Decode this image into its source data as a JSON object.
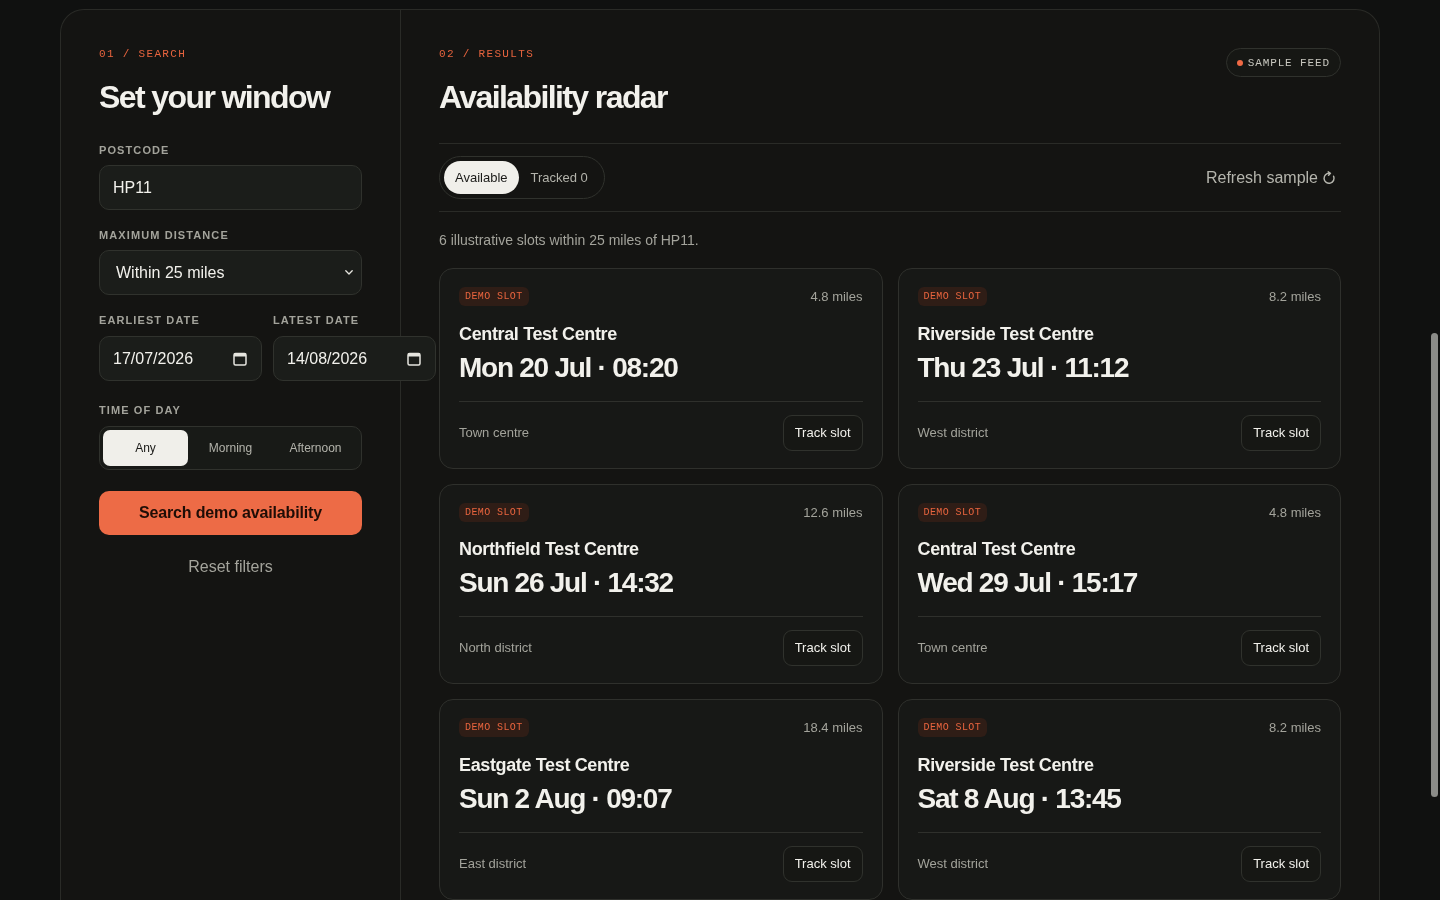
{
  "search_panel": {
    "section_label": "01 / SEARCH",
    "title": "Set your window",
    "postcode": {
      "label": "POSTCODE",
      "value": "HP11"
    },
    "max_distance": {
      "label": "MAXIMUM DISTANCE",
      "value": "Within 25 miles"
    },
    "earliest_date": {
      "label": "EARLIEST DATE",
      "value": "17/07/2026"
    },
    "latest_date": {
      "label": "LATEST DATE",
      "value": "14/08/2026"
    },
    "time_of_day": {
      "label": "TIME OF DAY",
      "options": [
        {
          "label": "Any",
          "selected": true
        },
        {
          "label": "Morning",
          "selected": false
        },
        {
          "label": "Afternoon",
          "selected": false
        }
      ]
    },
    "search_button": "Search demo availability",
    "reset_link": "Reset filters"
  },
  "results_panel": {
    "section_label": "02 / RESULTS",
    "title": "Availability radar",
    "feed_badge": "SAMPLE FEED",
    "tabs": [
      {
        "label": "Available",
        "selected": true
      },
      {
        "label": "Tracked 0",
        "selected": false
      }
    ],
    "refresh_button": "Refresh sample",
    "summary": "6 illustrative slots within 25 miles of HP11.",
    "slots": [
      {
        "tag": "DEMO SLOT",
        "distance": "4.8 miles",
        "centre": "Central Test Centre",
        "when": "Mon 20 Jul · 08:20",
        "area": "Town centre",
        "action": "Track slot"
      },
      {
        "tag": "DEMO SLOT",
        "distance": "8.2 miles",
        "centre": "Riverside Test Centre",
        "when": "Thu 23 Jul · 11:12",
        "area": "West district",
        "action": "Track slot"
      },
      {
        "tag": "DEMO SLOT",
        "distance": "12.6 miles",
        "centre": "Northfield Test Centre",
        "when": "Sun 26 Jul · 14:32",
        "area": "North district",
        "action": "Track slot"
      },
      {
        "tag": "DEMO SLOT",
        "distance": "4.8 miles",
        "centre": "Central Test Centre",
        "when": "Wed 29 Jul · 15:17",
        "area": "Town centre",
        "action": "Track slot"
      },
      {
        "tag": "DEMO SLOT",
        "distance": "18.4 miles",
        "centre": "Eastgate Test Centre",
        "when": "Sun 2 Aug · 09:07",
        "area": "East district",
        "action": "Track slot"
      },
      {
        "tag": "DEMO SLOT",
        "distance": "8.2 miles",
        "centre": "Riverside Test Centre",
        "when": "Sat 8 Aug · 13:45",
        "area": "West district",
        "action": "Track slot"
      }
    ]
  }
}
